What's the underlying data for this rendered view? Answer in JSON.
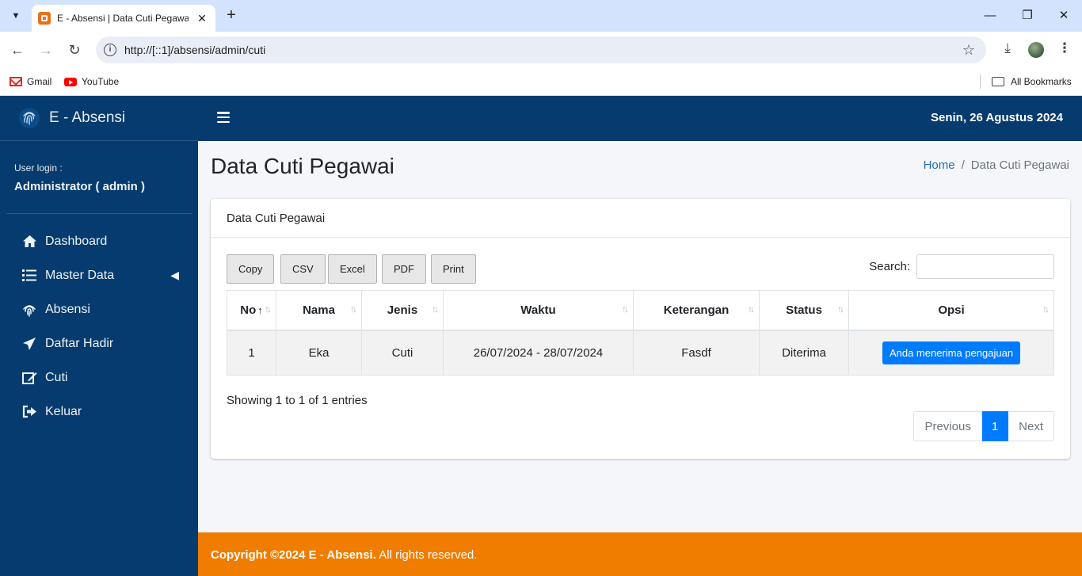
{
  "browser": {
    "tab_title": "E - Absensi | Data Cuti Pegawai",
    "url": "http://[::1]/absensi/admin/cuti",
    "bookmarks": [
      {
        "label": "Gmail",
        "icon": "gmail-icon"
      },
      {
        "label": "YouTube",
        "icon": "youtube-icon"
      }
    ],
    "all_bookmarks_label": "All Bookmarks"
  },
  "app": {
    "brand": "E - Absensi",
    "date": "Senin, 26 Agustus 2024",
    "colors": {
      "sidebar": "#053b6e",
      "footer": "#f07c00",
      "primary": "#007bff"
    }
  },
  "sidebar": {
    "user_label": "User login :",
    "user_name": "Administrator ( admin )",
    "items": [
      {
        "label": "Dashboard",
        "icon": "home-icon"
      },
      {
        "label": "Master Data",
        "icon": "list-icon"
      },
      {
        "label": "Absensi",
        "icon": "fingerprint-icon"
      },
      {
        "label": "Daftar Hadir",
        "icon": "paper-plane-icon"
      },
      {
        "label": "Cuti",
        "icon": "edit-icon"
      },
      {
        "label": "Keluar",
        "icon": "sign-out-icon"
      }
    ]
  },
  "page": {
    "title": "Data Cuti Pegawai",
    "breadcrumb": {
      "home": "Home",
      "current": "Data Cuti Pegawai"
    }
  },
  "card": {
    "header": "Data Cuti Pegawai",
    "export_buttons": [
      "Copy",
      "CSV",
      "Excel",
      "PDF",
      "Print"
    ],
    "search_label": "Search:",
    "search_value": "",
    "table": {
      "columns": [
        "No",
        "Nama",
        "Jenis",
        "Waktu",
        "Keterangan",
        "Status",
        "Opsi"
      ],
      "rows": [
        {
          "no": "1",
          "nama": "Eka",
          "jenis": "Cuti",
          "waktu": "26/07/2024 - 28/07/2024",
          "keterangan": "Fasdf",
          "status": "Diterima",
          "opsi": "Anda menerima pengajuan"
        }
      ]
    },
    "info": "Showing 1 to 1 of 1 entries",
    "pagination": {
      "previous": "Previous",
      "page": "1",
      "next": "Next"
    }
  },
  "footer": {
    "copyright": "Copyright ©2024 E - Absensi.",
    "rights": " All rights reserved."
  }
}
